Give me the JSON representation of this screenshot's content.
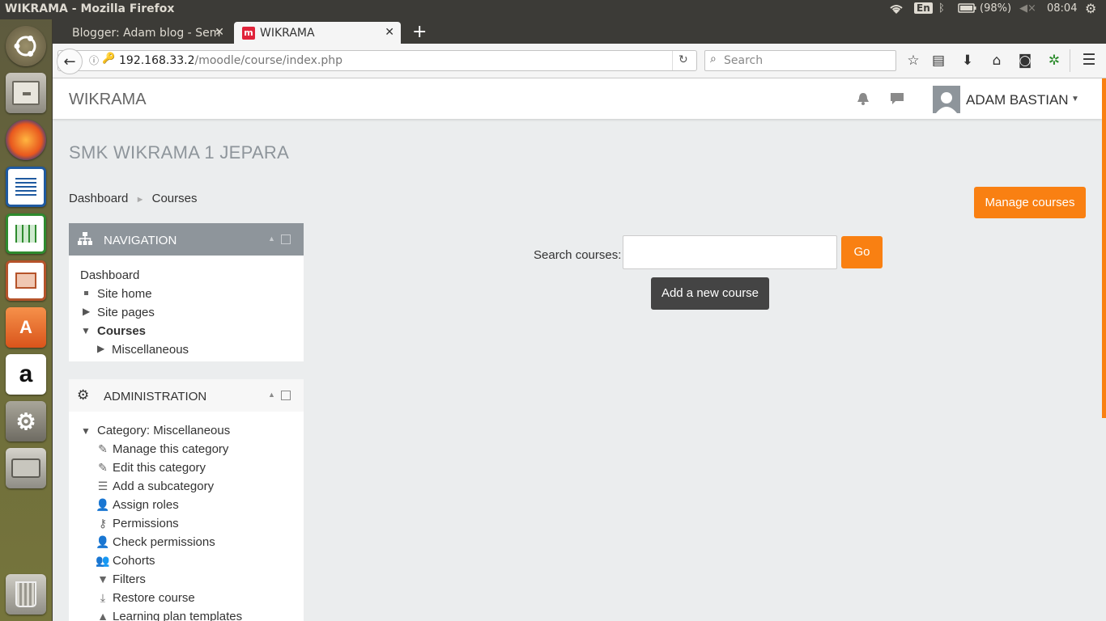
{
  "system": {
    "window_title": "WIKRAMA - Mozilla Firefox",
    "keyboard_layout": "En",
    "battery": "(98%)",
    "clock": "08:04"
  },
  "launcher": {
    "items": [
      "ubuntu-logo-icon",
      "files-cabinet-icon",
      "firefox-icon",
      "writer-icon",
      "calc-icon",
      "impress-icon",
      "software-center-icon",
      "amazon-icon",
      "system-settings-icon",
      "disk-drive-icon",
      "trash-icon"
    ]
  },
  "browser": {
    "tabs": [
      {
        "label": "Blogger: Adam blog - Sem"
      },
      {
        "label": "WIKRAMA"
      }
    ],
    "url_host": "192.168.33.2",
    "url_path": "/moodle/course/index.php",
    "search_placeholder": "Search"
  },
  "moodle": {
    "brand": "WIKRAMA",
    "user_name": "ADAM BASTIAN",
    "site_heading": "SMK WIKRAMA 1 JEPARA",
    "breadcrumb": [
      "Dashboard",
      "Courses"
    ],
    "breadcrumb_sep": "►",
    "manage_courses": "Manage courses",
    "search_label": "Search courses:",
    "search_value": "",
    "go_button": "Go",
    "add_course_button": "Add a new course",
    "navigation": {
      "title": "NAVIGATION",
      "items": [
        "Dashboard",
        "Site home",
        "Site pages",
        "Courses",
        "Miscellaneous"
      ]
    },
    "administration": {
      "title": "ADMINISTRATION",
      "category": "Category: Miscellaneous",
      "items": [
        "Manage this category",
        "Edit this category",
        "Add a subcategory",
        "Assign roles",
        "Permissions",
        "Check permissions",
        "Cohorts",
        "Filters",
        "Restore course",
        "Learning plan templates"
      ]
    },
    "colors": {
      "accent": "#f98012",
      "nav_header": "#8e959b",
      "dark_button": "#444444"
    }
  }
}
